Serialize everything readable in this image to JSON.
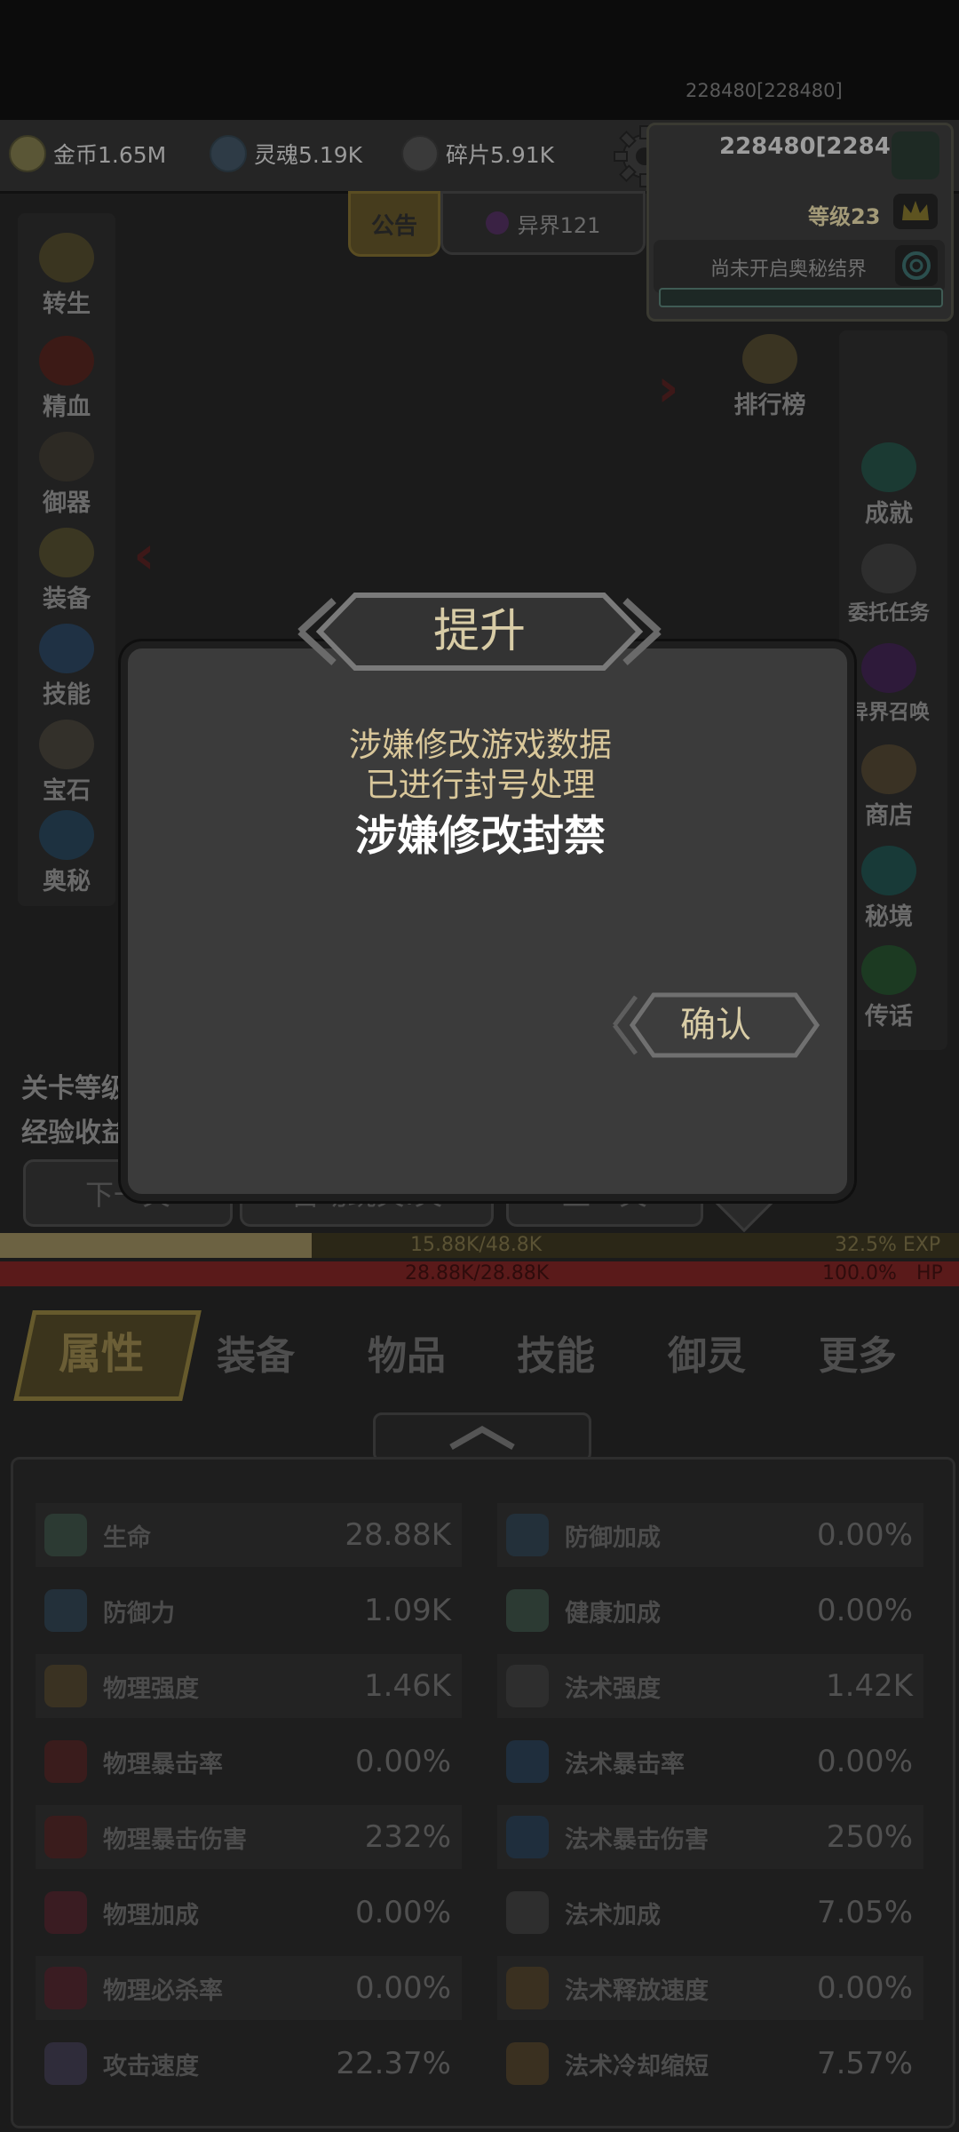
{
  "top": {
    "hp_readout": "228480[228480]"
  },
  "resources": [
    {
      "icon": "gold-coin-icon",
      "label": "金币1.65M"
    },
    {
      "icon": "soul-icon",
      "label": "灵魂5.19K"
    },
    {
      "icon": "shard-icon",
      "label": "碎片5.91K"
    }
  ],
  "status": {
    "power": "228480[228480]",
    "level": "等级23",
    "realm_text": "尚未开启奥秘结界"
  },
  "notice_tab": "公告",
  "otherworld_tab": "异界121",
  "left_menu": [
    "转生",
    "精血",
    "御器",
    "装备",
    "技能",
    "宝石",
    "奥秘"
  ],
  "right_menu_top": [
    "排行榜",
    "设置"
  ],
  "right_menu": [
    "成就",
    "委托任务",
    "异界召唤",
    "商店",
    "秘境",
    "传话"
  ],
  "stage": {
    "level_label": "关卡等级",
    "exp_label": "经验收益"
  },
  "nav_buttons": [
    "下一关",
    "自动跳关:关",
    "上一关"
  ],
  "exp_bar": {
    "text": "15.88K/48.8K",
    "percent": "32.5% EXP",
    "fill": 0.325
  },
  "hp_bar": {
    "text": "28.88K/28.88K",
    "percent": "100.0%",
    "unit": "HP",
    "fill": 1.0
  },
  "tabs": [
    "属性",
    "装备",
    "物品",
    "技能",
    "御灵",
    "更多"
  ],
  "active_tab": "属性",
  "collapse_icon": "chevron-up-icon",
  "stats_left": [
    {
      "name": "生命",
      "value": "28.88K"
    },
    {
      "name": "防御力",
      "value": "1.09K"
    },
    {
      "name": "物理强度",
      "value": "1.46K"
    },
    {
      "name": "物理暴击率",
      "value": "0.00%"
    },
    {
      "name": "物理暴击伤害",
      "value": "232%"
    },
    {
      "name": "物理加成",
      "value": "0.00%"
    },
    {
      "name": "物理必杀率",
      "value": "0.00%"
    },
    {
      "name": "攻击速度",
      "value": "22.37%"
    }
  ],
  "stats_right": [
    {
      "name": "防御加成",
      "value": "0.00%"
    },
    {
      "name": "健康加成",
      "value": "0.00%"
    },
    {
      "name": "法术强度",
      "value": "1.42K"
    },
    {
      "name": "法术暴击率",
      "value": "0.00%"
    },
    {
      "name": "法术暴击伤害",
      "value": "250%"
    },
    {
      "name": "法术加成",
      "value": "7.05%"
    },
    {
      "name": "法术释放速度",
      "value": "0.00%"
    },
    {
      "name": "法术冷却缩短",
      "value": "7.57%"
    }
  ],
  "dialog": {
    "title": "提升",
    "line1": "涉嫌修改游戏数据",
    "line2": "已进行封号处理",
    "line3": "涉嫌修改封禁",
    "confirm": "确认"
  },
  "colors": {
    "gold": "#d8cca6",
    "hp_red": "#5a1a1a",
    "exp_gold": "#6c6242"
  }
}
